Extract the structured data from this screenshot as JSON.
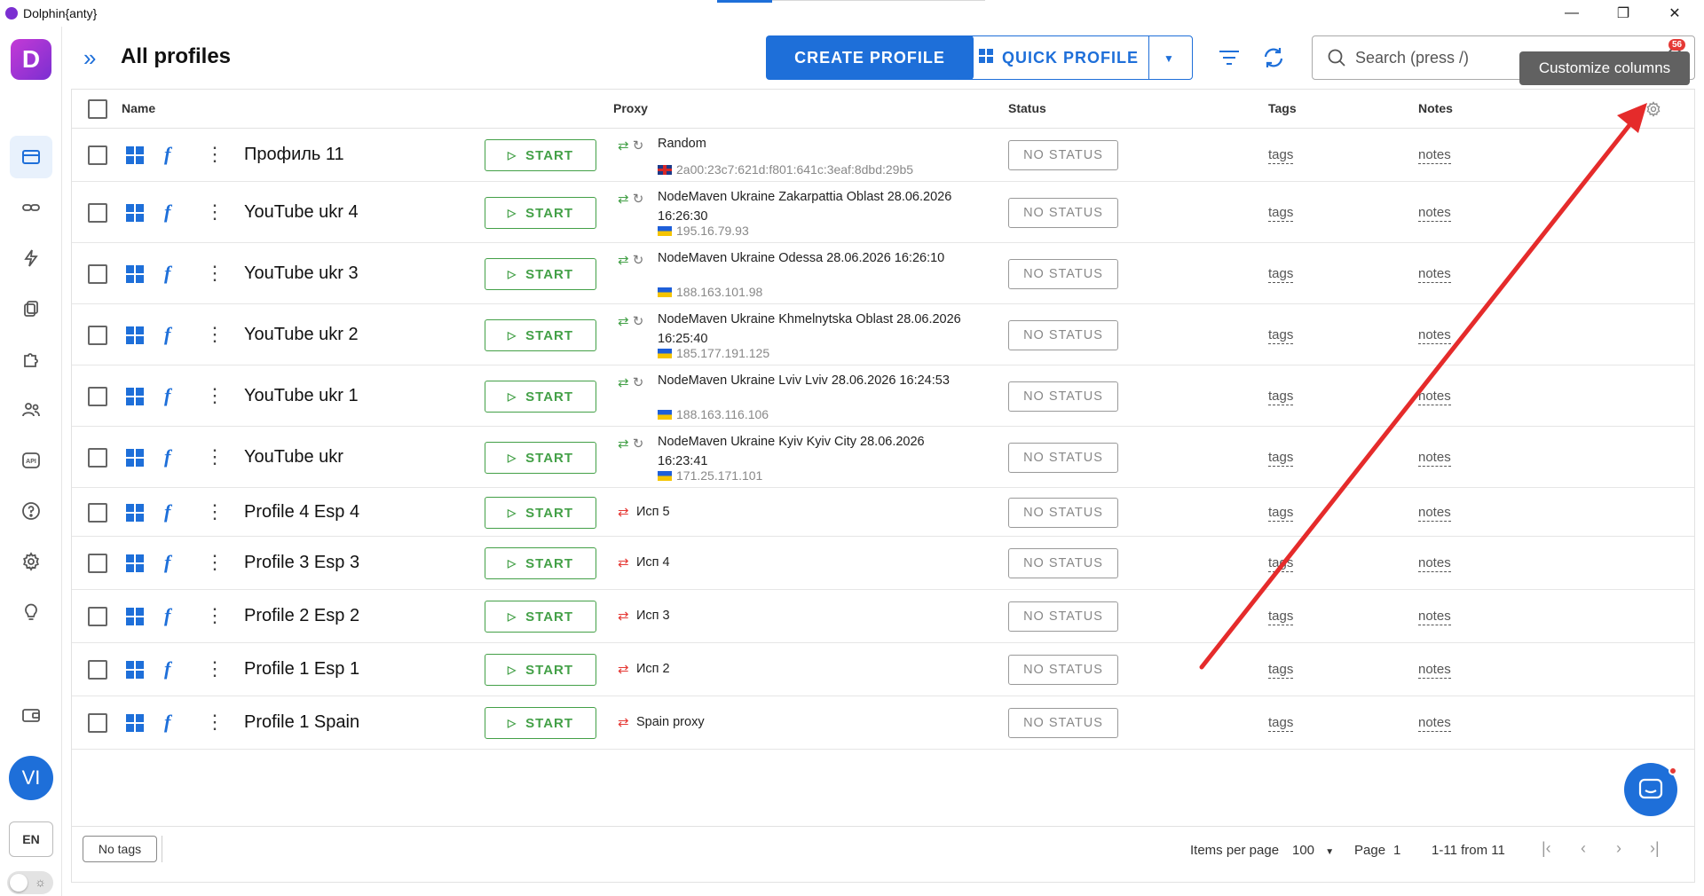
{
  "window": {
    "title": "Dolphin{anty}",
    "minimize": "—",
    "restore": "❐",
    "close": "✕"
  },
  "brand": {
    "letter": "D"
  },
  "header": {
    "title": "All profiles",
    "create_label": "CREATE PROFILE",
    "quick_label": "QUICK PROFILE",
    "search_placeholder": "Search (press /)",
    "notification_count": "56",
    "tooltip": "Customize columns"
  },
  "user": {
    "initials": "VI",
    "language": "EN"
  },
  "table": {
    "columns": {
      "name": "Name",
      "proxy": "Proxy",
      "status": "Status",
      "tags": "Tags",
      "notes": "Notes"
    },
    "start_label": "START",
    "status_label": "NO STATUS",
    "tags_label": "tags",
    "notes_label": "notes",
    "rows": [
      {
        "name": "Профиль 11",
        "proxy": "Random",
        "ip": "2a00:23c7:621d:f801:641c:3eaf:8dbd:29b5",
        "flag": "uk",
        "proxy_ok": true
      },
      {
        "name": "YouTube ukr 4",
        "proxy": "NodeMaven Ukraine Zakarpattia Oblast 28.06.2026 16:26:30",
        "ip": "195.16.79.93",
        "flag": "ua",
        "proxy_ok": true
      },
      {
        "name": "YouTube ukr 3",
        "proxy": "NodeMaven Ukraine Odessa 28.06.2026 16:26:10",
        "ip": "188.163.101.98",
        "flag": "ua",
        "proxy_ok": true
      },
      {
        "name": "YouTube ukr 2",
        "proxy": "NodeMaven Ukraine Khmelnytska Oblast 28.06.2026 16:25:40",
        "ip": "185.177.191.125",
        "flag": "ua",
        "proxy_ok": true
      },
      {
        "name": "YouTube ukr 1",
        "proxy": "NodeMaven Ukraine Lviv Lviv 28.06.2026 16:24:53",
        "ip": "188.163.116.106",
        "flag": "ua",
        "proxy_ok": true
      },
      {
        "name": "YouTube ukr",
        "proxy": "NodeMaven Ukraine Kyiv Kyiv City 28.06.2026 16:23:41",
        "ip": "171.25.171.101",
        "flag": "ua",
        "proxy_ok": true
      },
      {
        "name": "Profile 4 Esp 4",
        "proxy": "Исп 5",
        "proxy_ok": false
      },
      {
        "name": "Profile 3 Esp 3",
        "proxy": "Исп 4",
        "proxy_ok": false
      },
      {
        "name": "Profile 2 Esp 2",
        "proxy": "Исп 3",
        "proxy_ok": false
      },
      {
        "name": "Profile 1 Esp 1",
        "proxy": "Исп 2",
        "proxy_ok": false
      },
      {
        "name": "Profile 1 Spain",
        "proxy": "Spain proxy",
        "proxy_ok": false
      }
    ]
  },
  "footer": {
    "no_tags": "No tags",
    "items_per_page_label": "Items per page",
    "items_per_page_value": "100",
    "page_label": "Page",
    "page_value": "1",
    "range": "1-11 from 11"
  },
  "colors": {
    "accent": "#1e6fd9",
    "start": "#43a047",
    "brand": "#7b2fd1",
    "annotation": "#e52b2b"
  }
}
